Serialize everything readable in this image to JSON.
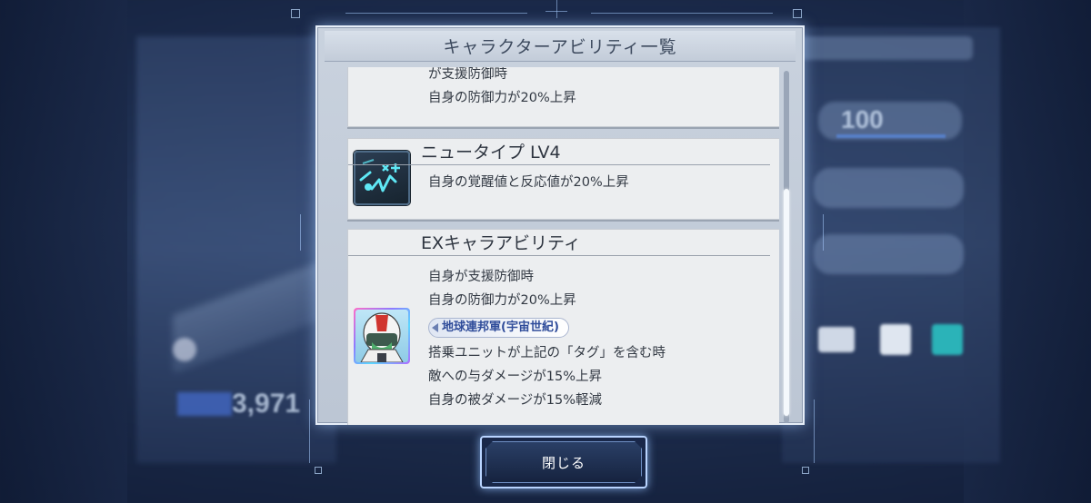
{
  "dialog": {
    "title": "キャラクターアビリティ一覧"
  },
  "cards": [
    {
      "lines": [
        "が支援防御時",
        "自身の防御力が20%上昇"
      ]
    },
    {
      "title": "ニュータイプ LV4",
      "lines": [
        "自身の覚醒値と反応値が20%上昇"
      ],
      "icon": "newtype-ability-icon"
    },
    {
      "title": "EXキャラアビリティ",
      "lines": [
        "自身が支援防御時",
        "自身の防御力が20%上昇"
      ],
      "tag": "地球連邦軍(宇宙世紀)",
      "tag_lines": [
        "搭乗ユニットが上記の「タグ」を含む時",
        "敵への与ダメージが15%上昇",
        "自身の被ダメージが15%軽減"
      ],
      "icon": "character-portrait-icon"
    }
  ],
  "close_button": {
    "label": "閉じる"
  },
  "background": {
    "stat_value": "100",
    "power_value": "3,971"
  },
  "colors": {
    "accent": "#b9d4ff",
    "tag_text": "#2f4c9a",
    "card_bg": "#eceef0"
  }
}
